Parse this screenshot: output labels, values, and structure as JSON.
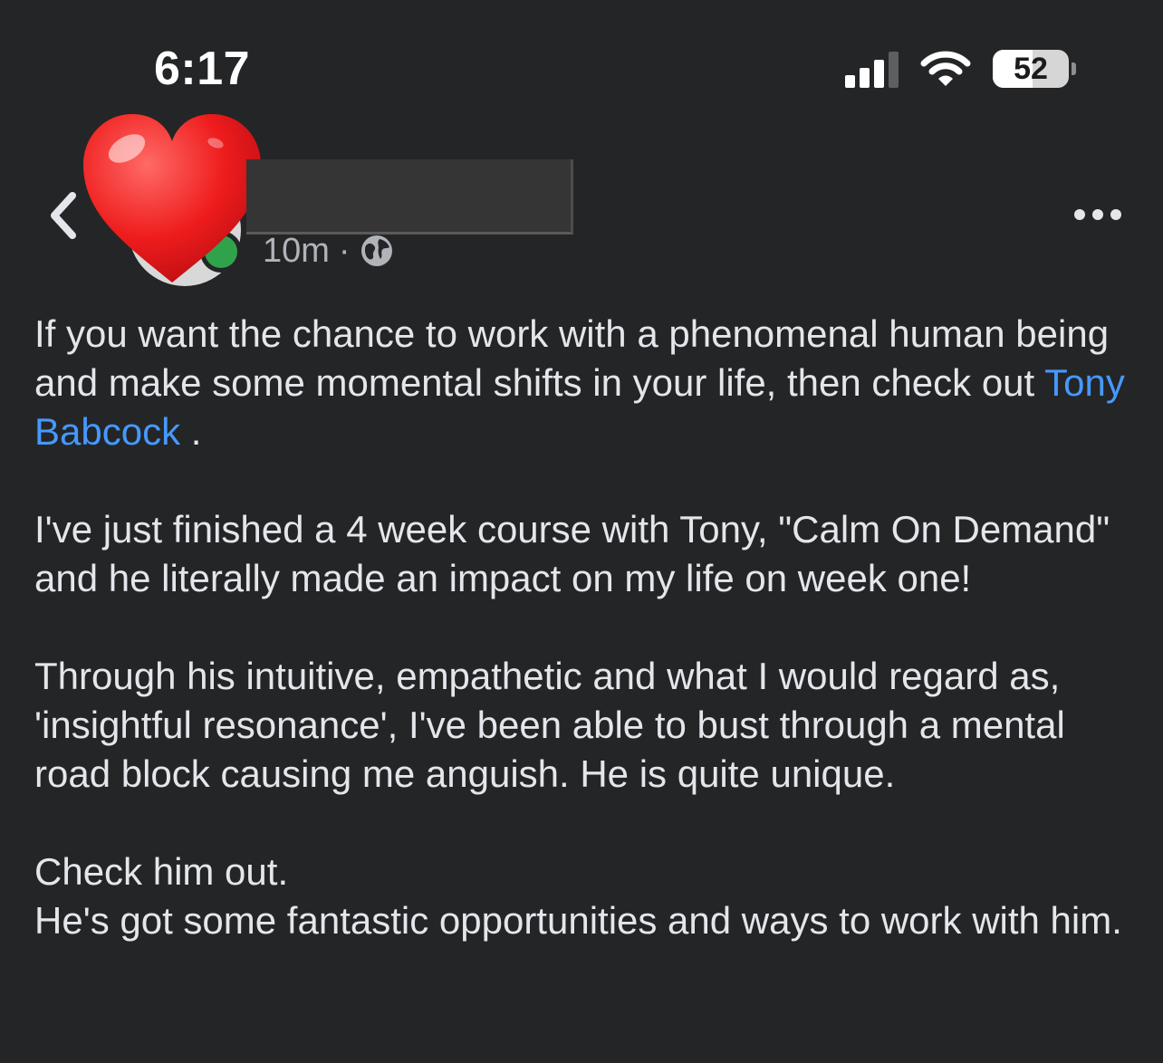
{
  "status_bar": {
    "time": "6:17",
    "battery_level": "52",
    "battery_fraction": 0.52,
    "signal_bars_active": 3,
    "signal_bars_total": 4
  },
  "post": {
    "timestamp": "10m",
    "separator": "·",
    "audience_icon": "globe-icon",
    "author_sticker": "heart-icon",
    "paragraphs": [
      {
        "before": "If you want the chance to work with a phenomenal human being and make some momental shifts in your life, then check out ",
        "mention": "Tony Babcock",
        "after": " ."
      },
      {
        "text": "I've just finished a 4 week course with Tony, \"Calm On Demand\" and he literally made an impact on my life on week one!"
      },
      {
        "text": "Through his intuitive, empathetic and what I would  regard as, 'insightful resonance', I've been able to  bust through a mental road block causing me anguish. He is quite unique."
      },
      {
        "line1": "Check him out.",
        "line2": "He's got some fantastic opportunities and ways to work with him."
      }
    ]
  },
  "colors": {
    "background": "#242526",
    "text": "#e4e6eb",
    "secondary_text": "#b0b3b8",
    "mention": "#4599ff",
    "online": "#31a24c"
  }
}
